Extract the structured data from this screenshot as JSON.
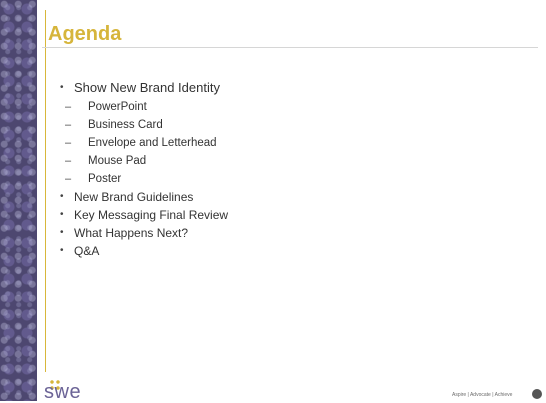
{
  "slide": {
    "title": "Agenda",
    "items": [
      {
        "level": 1,
        "marker": "•",
        "text": "Show New Brand Identity"
      },
      {
        "level": 2,
        "marker": "–",
        "text": "PowerPoint"
      },
      {
        "level": 2,
        "marker": "–",
        "text": "Business Card"
      },
      {
        "level": 2,
        "marker": "–",
        "text": "Envelope and Letterhead"
      },
      {
        "level": 2,
        "marker": "–",
        "text": "Mouse Pad"
      },
      {
        "level": 2,
        "marker": "–",
        "text": "Poster"
      },
      {
        "level": 1,
        "marker": "•",
        "text": "New Brand Guidelines"
      },
      {
        "level": 1,
        "marker": "•",
        "text": "Key Messaging Final Review"
      },
      {
        "level": 1,
        "marker": "•",
        "text": "What Happens Next?"
      },
      {
        "level": 1,
        "marker": "•",
        "text": "Q&A"
      }
    ]
  },
  "footer": {
    "logo_text": "swe",
    "tagline": "Aspire | Advocate | Achieve"
  },
  "colors": {
    "accent_gold": "#d6b53b",
    "sidebar_purple": "#4d4770",
    "logo_purple": "#6b6396"
  }
}
